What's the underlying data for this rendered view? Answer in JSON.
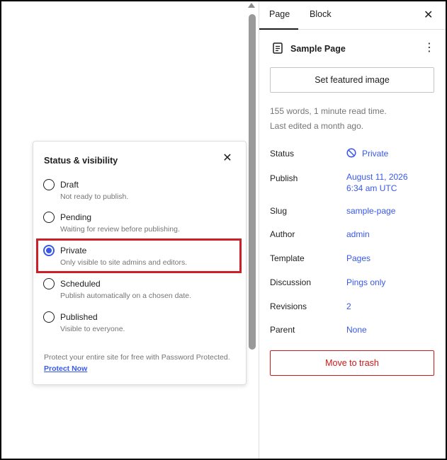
{
  "tabs": {
    "page": "Page",
    "block": "Block"
  },
  "page": {
    "title": "Sample Page"
  },
  "featured_image_button": "Set featured image",
  "meta": {
    "words": "155 words, 1 minute read time.",
    "edited": "Last edited a month ago."
  },
  "rows": {
    "status": {
      "label": "Status",
      "value": "Private"
    },
    "publish": {
      "label": "Publish",
      "value_line1": "August 11, 2026",
      "value_line2": "6:34 am UTC"
    },
    "slug": {
      "label": "Slug",
      "value": "sample-page"
    },
    "author": {
      "label": "Author",
      "value": "admin"
    },
    "template": {
      "label": "Template",
      "value": "Pages"
    },
    "discussion": {
      "label": "Discussion",
      "value": "Pings only"
    },
    "revisions": {
      "label": "Revisions",
      "value": "2"
    },
    "parent": {
      "label": "Parent",
      "value": "None"
    }
  },
  "trash_button": "Move to trash",
  "popover": {
    "title": "Status & visibility",
    "options": [
      {
        "label": "Draft",
        "desc": "Not ready to publish."
      },
      {
        "label": "Pending",
        "desc": "Waiting for review before publishing."
      },
      {
        "label": "Private",
        "desc": "Only visible to site admins and editors."
      },
      {
        "label": "Scheduled",
        "desc": "Publish automatically on a chosen date."
      },
      {
        "label": "Published",
        "desc": "Visible to everyone."
      }
    ],
    "selected": "Private",
    "note": "Protect your entire site for free with Password Protected.",
    "note_link": "Protect Now"
  },
  "colors": {
    "accent": "#3858e9",
    "danger": "#cc1818",
    "highlight": "#cc1f27"
  },
  "icons": {
    "close": "close-icon",
    "document": "document-icon",
    "kebab": "more-vertical-icon",
    "status": "private-status-icon"
  }
}
